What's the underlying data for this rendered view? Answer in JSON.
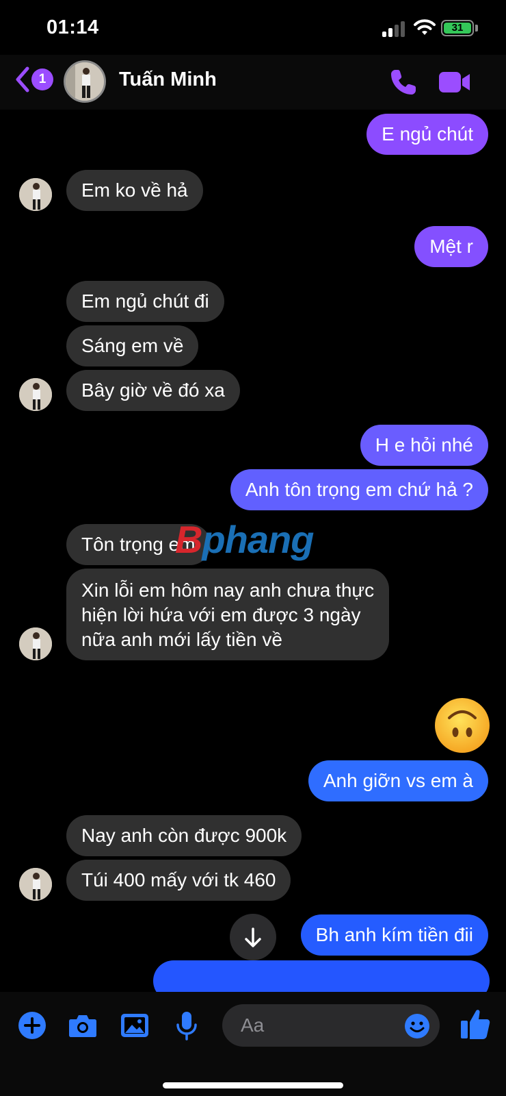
{
  "status_bar": {
    "time": "01:14",
    "battery": "31"
  },
  "header": {
    "back_count": "1",
    "contact_name": "Tuấn Minh"
  },
  "messages": [
    {
      "from": "me",
      "text": "E ngủ chút"
    },
    {
      "from": "them",
      "text": "Em ko về hả"
    },
    {
      "from": "me",
      "text": "Mệt r"
    },
    {
      "from": "them",
      "text": "Em ngủ chút đi"
    },
    {
      "from": "them",
      "text": "Sáng em về"
    },
    {
      "from": "them",
      "text": "Bây giờ về đó xa"
    },
    {
      "from": "me",
      "text": "H e hỏi nhé"
    },
    {
      "from": "me",
      "text": "Anh tôn trọng em chứ hả ?"
    },
    {
      "from": "them",
      "text": "Tôn trọng em"
    },
    {
      "from": "them",
      "text": "Xin lỗi em hôm nay anh chưa thực\nhiện lời hứa với em được 3 ngày\nnữa anh mới lấy tiền về"
    },
    {
      "from": "me",
      "type": "emoji",
      "emoji": "upside-down-face"
    },
    {
      "from": "me",
      "text": "Anh giỡn vs em à"
    },
    {
      "from": "them",
      "text": "Nay anh còn được 900k"
    },
    {
      "from": "them",
      "text": "Túi 400 mấy với tk 460"
    },
    {
      "from": "me",
      "text": "Bh anh kím tiền đii"
    }
  ],
  "watermark": {
    "first_letter": "B",
    "rest": "phang"
  },
  "composer": {
    "placeholder": "Aa"
  },
  "colors": {
    "bubble_in": "#303030",
    "bubble_out_top": "#8a4dff",
    "bubble_out_bottom": "#2a5bff",
    "accent": "#9b4dff",
    "blue_accent": "#2f7bff"
  }
}
